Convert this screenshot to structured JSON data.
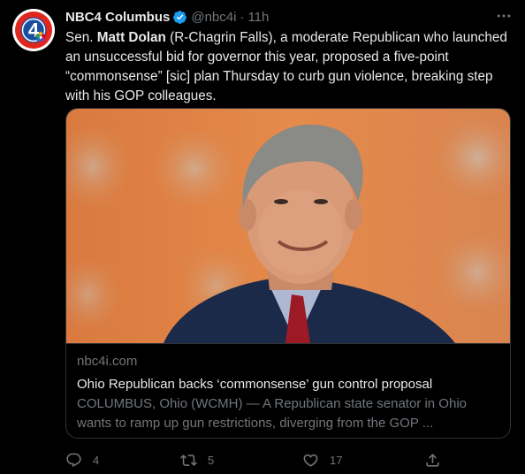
{
  "tweet": {
    "display_name": "NBC4 Columbus",
    "handle": "@nbc4i",
    "separator": "·",
    "time": "11h",
    "text_prefix": "Sen. ",
    "text_bold": "Matt Dolan",
    "text_rest": " (R-Chagrin Falls), a moderate Republican who launched an unsuccessful bid for governor this year, proposed a five-point “commonsense” [sic] plan Thursday to curb gun violence, breaking step with his GOP colleagues."
  },
  "avatar": {
    "logo_text": "4",
    "colors": {
      "ring": "#e1261c",
      "inner": "#1a4fa0"
    }
  },
  "card": {
    "domain": "nbc4i.com",
    "title": "Ohio Republican backs ‘commonsense’ gun control proposal",
    "description": "COLUMBUS, Ohio (WCMH) — A Republican state senator in Ohio wants to ramp up gun restrictions, diverging from the GOP ..."
  },
  "actions": {
    "reply_count": "4",
    "retweet_count": "5",
    "like_count": "17"
  },
  "icons": {
    "verified": "verified-badge-icon",
    "more": "more-icon",
    "reply": "reply-icon",
    "retweet": "retweet-icon",
    "like": "like-icon",
    "share": "share-icon"
  },
  "colors": {
    "background": "#000000",
    "text": "#e7e9ea",
    "muted": "#71767b",
    "verified": "#1d9bf0",
    "border": "#2f3336"
  }
}
